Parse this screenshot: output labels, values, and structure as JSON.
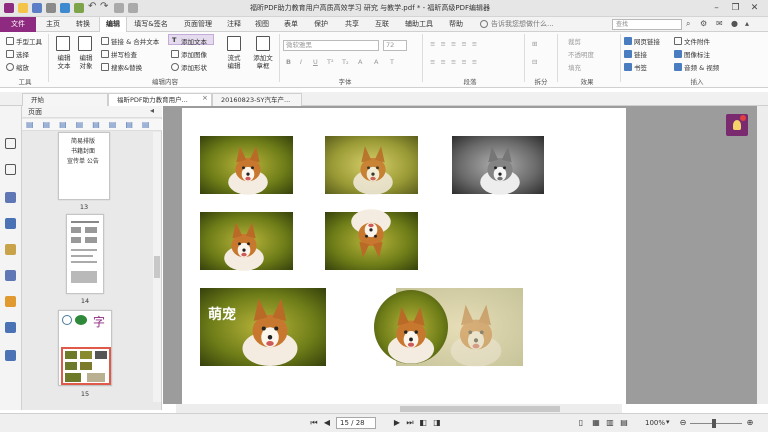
{
  "app": {
    "title": "福昕PDF助力教育用户高质高效学习 研究 与教学.pdf * - 福昕高级PDF编辑器"
  },
  "colors": {
    "accent": "#8e2a7f",
    "doc_bg": "#9c9c9c",
    "selection": "#e05a4a"
  },
  "menu": {
    "file": "文件",
    "home": "主页",
    "convert": "转换",
    "edit": "编辑",
    "fill_sign": "填写&签名",
    "page_manage": "页面管理",
    "comment": "注释",
    "view": "视图",
    "form": "表单",
    "protect": "保护",
    "share": "共享",
    "interact": "互联",
    "assist": "辅助工具",
    "help": "帮助",
    "tell_me": "告诉我您想做什么...",
    "search_placeholder": "查找"
  },
  "ribbon": {
    "tools": {
      "hand": "手型工具",
      "select": "选择",
      "zoom": "缩放",
      "label": "工具"
    },
    "edit_text": "编辑文本",
    "edit_object": "编辑对象",
    "link_merge": "链接 & 合并文本",
    "spell_check": "拼写检查",
    "find_replace": "搜索&替换",
    "add_text": "添加文本",
    "add_image": "添加图像",
    "add_shape": "添加形状",
    "flow_edit": "流式编辑",
    "add_textbox": "添加文章框",
    "edit_content_label": "编辑内容",
    "font_name": "微软雅黑",
    "font_size": "72",
    "font_label": "字体",
    "para_label": "段落",
    "split_label": "拆分",
    "effect_label": "效果",
    "crop": "裁剪",
    "opacity": "不透明度",
    "fill": "填充",
    "file_link": "网页链接",
    "link": "链接",
    "bookmark": "书签",
    "attachment": "文件附件",
    "image_anno": "图像标注",
    "audio_video": "音频 & 视频",
    "insert_label": "插入"
  },
  "tabs": [
    {
      "label": "开始"
    },
    {
      "label": "福昕PDF助力教育用户..."
    },
    {
      "label": "20160823-SY汽车产..."
    }
  ],
  "panel": {
    "title": "页面",
    "pages": [
      "13",
      "14",
      "15"
    ],
    "p13_lines": [
      "简易排版",
      "书籍封面",
      "宣传单 公告"
    ]
  },
  "page_content": {
    "caption": "萌宠"
  },
  "status": {
    "page": "15 / 28",
    "zoom": "100%"
  }
}
